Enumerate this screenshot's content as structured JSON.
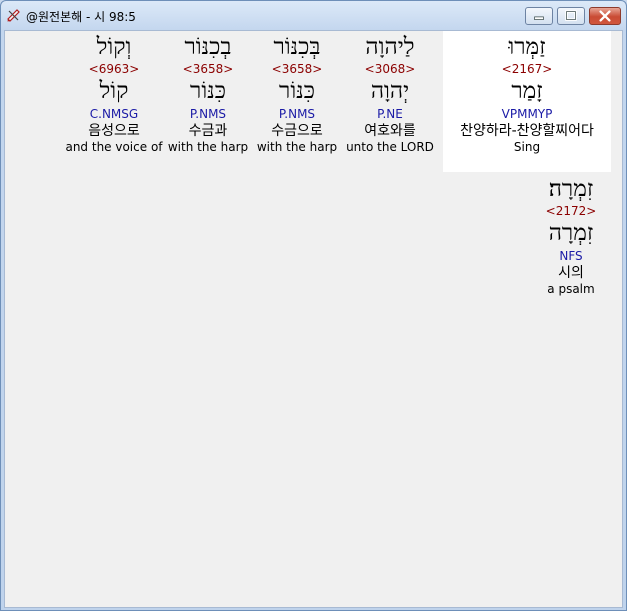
{
  "window": {
    "title": "@원전본해 - 시 98:5",
    "icon": "pencil-ruler-icon"
  },
  "controls": {
    "minimize_icon": "minimize-icon",
    "maximize_icon": "maximize-icon",
    "close_icon": "close-icon"
  },
  "words": [
    {
      "hebrew": "וְקוֹל",
      "strong": "<6963>",
      "lemma": "קוֹל",
      "morph": "C.NMSG",
      "korean": "음성으로",
      "english": "and the voice of"
    },
    {
      "hebrew": "בְכִנּוֹר",
      "strong": "<3658>",
      "lemma": "כִּנּוֹר",
      "morph": "P.NMS",
      "korean": "수금과",
      "english": "with the harp"
    },
    {
      "hebrew": "בְּכִנּוֹר",
      "strong": "<3658>",
      "lemma": "כִּנּוֹר",
      "morph": "P.NMS",
      "korean": "수금으로",
      "english": "with the harp"
    },
    {
      "hebrew": "לַיהוָה",
      "strong": "<3068>",
      "lemma": "יְהוָה",
      "morph": "P.NE",
      "korean": "여호와를",
      "english": "unto the LORD"
    },
    {
      "hebrew": "זַמְּרוּ",
      "strong": "<2167>",
      "lemma": "זָמַר",
      "morph": "VPMMYP",
      "korean": "찬양하라-찬양할찌어다",
      "english": "Sing"
    },
    {
      "hebrew": "זִמְרָה׃",
      "strong": "<2172>",
      "lemma": "זִמְרָה",
      "morph": "NFS",
      "korean": "시의",
      "english": "a psalm"
    }
  ],
  "colors": {
    "strong": "#8b0000",
    "morph": "#1a1aa6",
    "highlight": "#ffffff"
  }
}
